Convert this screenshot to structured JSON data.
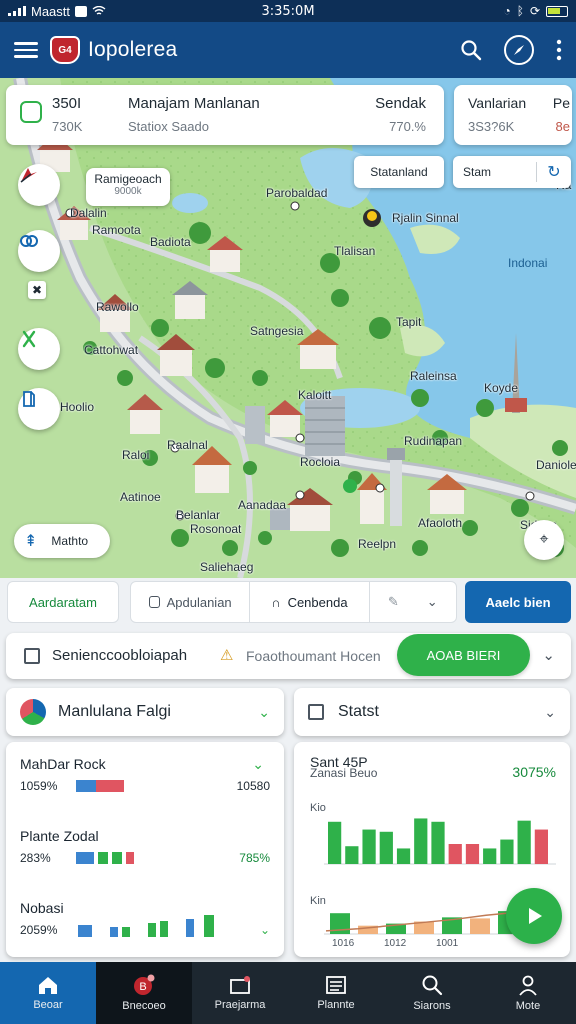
{
  "status_bar": {
    "carrier": "Maastt",
    "time": "3:35:0M"
  },
  "app_bar": {
    "logo_text": "G4",
    "title": "Iopolerea",
    "icons": [
      "menu-icon",
      "search-icon",
      "compass-icon",
      "more-vert-icon"
    ]
  },
  "summary_card": {
    "col1_title": "350I",
    "col1_value": "730K",
    "col2_title": "Manajam Manlanan",
    "col2_sub": "Statiox Saado",
    "col3_title": "Sendak",
    "col3_value": "770.%"
  },
  "side_card": {
    "title": "Vanlarian",
    "value": "3S3?6K",
    "badge_top": "Pe",
    "badge_bottom": "8e"
  },
  "map": {
    "tooltip_title": "Ramigeoach",
    "tooltip_sub": "9000k",
    "chip_station": "Statanland",
    "chip_stam": "Stam",
    "fab_tag": "Mathto",
    "labels": [
      "Parobaldad",
      "Rjalin Sinnal",
      "Dalalin",
      "Badiota",
      "Tlalisan",
      "Indonai",
      "Rawollo",
      "Tapit",
      "Satngesia",
      "Raleinsa",
      "Kaloitt",
      "Hoolio",
      "Koyde",
      "Raalnal",
      "Raloi",
      "Rudinapan",
      "Rocloia",
      "Daniole",
      "Rosonoat",
      "Reelpn",
      "Ramoota",
      "Cattohwat",
      "Aatinoe",
      "Saliehaeg",
      "Aanadaa",
      "Belanlar",
      "Sidnos",
      "Afaoloth",
      "Ra"
    ]
  },
  "action_row": {
    "left_button": "Aardaratam",
    "seg1": "Apdulanian",
    "seg2": "Cenbenda",
    "right_button": "Aaelc bien"
  },
  "search_row": {
    "label": "Senienccoobloiapah",
    "sublabel": "Foaothoumant Hocen",
    "pill": "AOAB BIERI"
  },
  "left_dropdown": {
    "label": "Manlulana Falgi"
  },
  "right_dropdown": {
    "label": "Statst"
  },
  "list": [
    {
      "title": "MahDar Rock",
      "left_value": "1059%",
      "right_value": "10580",
      "colors": [
        "#3b84cf",
        "#e05561"
      ]
    },
    {
      "title": "Plante Zodal",
      "left_value": "283%",
      "right_value": "785%",
      "colors": [
        "#3b84cf",
        "#2fb14a",
        "#e05561"
      ]
    },
    {
      "title": "Nobasi",
      "left_value": "2059%",
      "right_value": "",
      "colors": []
    }
  ],
  "chart_data": {
    "type": "bar",
    "title": "Sant 45P",
    "subtitle": "Zanasi Beuo",
    "summary_value": "3075%",
    "ylabel_top": "Kio",
    "ylabel_bottom": "Kin",
    "ticks_bottom": [
      "1016",
      "1012",
      "1001"
    ],
    "bars_top": [
      {
        "value": 3.8,
        "color": "#2fb14a"
      },
      {
        "value": 1.6,
        "color": "#2fb14a"
      },
      {
        "value": 3.1,
        "color": "#2fb14a"
      },
      {
        "value": 2.9,
        "color": "#2fb14a"
      },
      {
        "value": 1.4,
        "color": "#2fb14a"
      },
      {
        "value": 4.1,
        "color": "#2fb14a"
      },
      {
        "value": 3.8,
        "color": "#2fb14a"
      },
      {
        "value": 1.8,
        "color": "#e05561"
      },
      {
        "value": 1.8,
        "color": "#e05561"
      },
      {
        "value": 1.4,
        "color": "#2fb14a"
      },
      {
        "value": 2.2,
        "color": "#2fb14a"
      },
      {
        "value": 3.9,
        "color": "#2fb14a"
      },
      {
        "value": 3.1,
        "color": "#e05561"
      }
    ],
    "bars_bottom": [
      {
        "value": 2.0,
        "color": "#2fb14a"
      },
      {
        "value": 0.8,
        "color": "#f2b27d"
      },
      {
        "value": 1.0,
        "color": "#2fb14a"
      },
      {
        "value": 1.2,
        "color": "#f2b27d"
      },
      {
        "value": 1.6,
        "color": "#2fb14a"
      },
      {
        "value": 1.5,
        "color": "#f2b27d"
      },
      {
        "value": 2.2,
        "color": "#2fb14a"
      },
      {
        "value": 1.9,
        "color": "#f2b27d"
      }
    ],
    "trend": [
      0.3,
      0.5,
      0.8,
      1.1,
      1.4,
      1.8,
      2.1,
      2.3
    ]
  },
  "bottom_nav": [
    {
      "label": "Beoar",
      "icon": "home-icon"
    },
    {
      "label": "Bnecoeo",
      "icon": "badge-icon"
    },
    {
      "label": "Praejarma",
      "icon": "folder-icon"
    },
    {
      "label": "Plannte",
      "icon": "list-icon"
    },
    {
      "label": "Siarons",
      "icon": "search-icon"
    },
    {
      "label": "Mote",
      "icon": "person-icon"
    }
  ],
  "colors": {
    "app_bar": "#134a86",
    "primary_blue": "#1467b0",
    "green": "#2fb14a",
    "red": "#e05561",
    "nav_bg": "#1d2730"
  }
}
